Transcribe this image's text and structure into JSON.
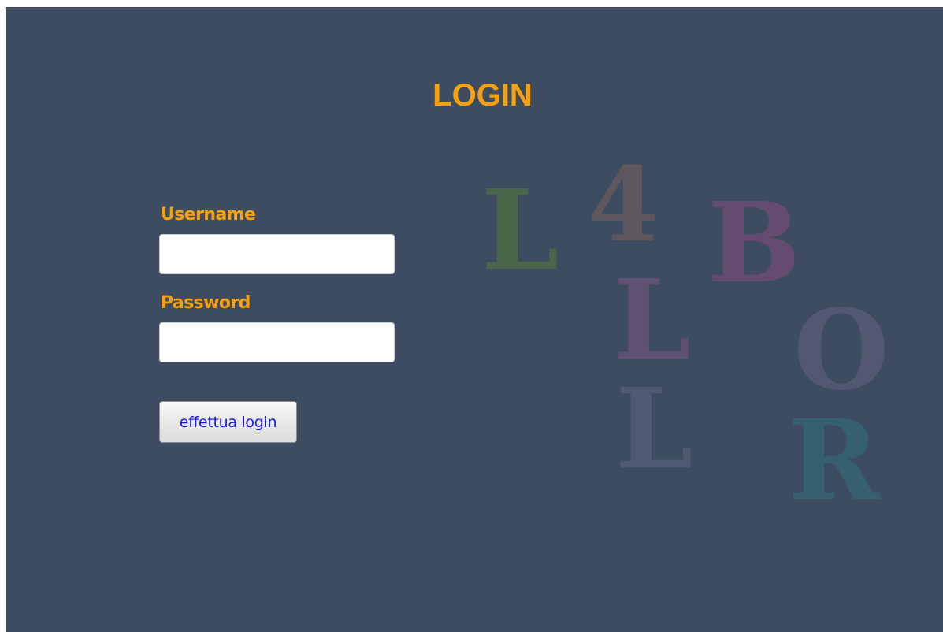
{
  "page": {
    "title": "LOGIN"
  },
  "form": {
    "username_label": "Username",
    "username_value": "",
    "password_label": "Password",
    "password_value": "",
    "submit_label": "effettua login"
  },
  "logo": {
    "letters": [
      {
        "char": "L",
        "color": "#5a8a2c"
      },
      {
        "char": "4",
        "color": "#8a6a5a"
      },
      {
        "char": "B",
        "color": "#9a4a82"
      },
      {
        "char": "L",
        "color": "#8a5a86"
      },
      {
        "char": "O",
        "color": "#6e6888"
      },
      {
        "char": "L",
        "color": "#6a6f8a"
      },
      {
        "char": "R",
        "color": "#2f7a8a"
      }
    ]
  },
  "colors": {
    "background": "#3e4c62",
    "accent": "#f6a10f",
    "button_text": "#1a1aee"
  }
}
